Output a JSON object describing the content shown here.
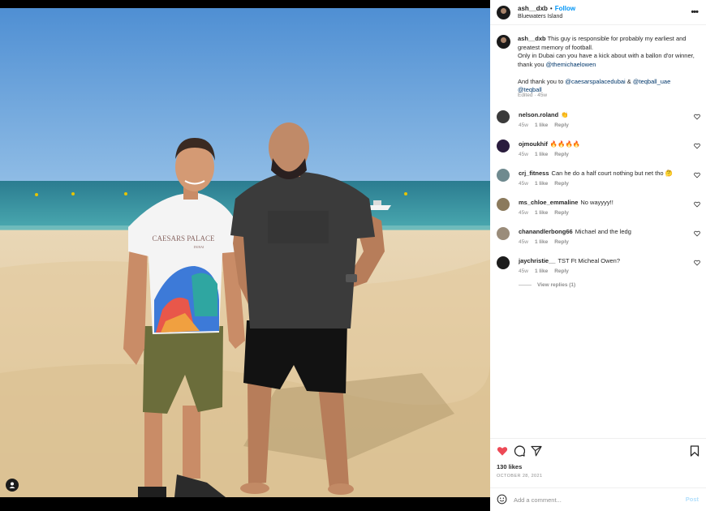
{
  "post": {
    "username": "ash__dxb",
    "separator": "•",
    "follow_label": "Follow",
    "location": "Bluewaters Island",
    "caption": {
      "username": "ash__dxb",
      "line1": "This guy is responsible for probably my earliest and greatest memory of football.",
      "line2_prefix": "Only in Dubai can you have a kick about with a ballon d'or winner, thank you ",
      "mention1": "@themichaelowen",
      "line3_prefix": "And thank you to ",
      "mention2": "@caesarspalacedubai",
      "amp": " & ",
      "mention3": "@teqball_uae",
      "mention4": "@teqball"
    },
    "edited": "Edited · 45w",
    "likes": "130 likes",
    "date": "OCTOBER 28, 2021"
  },
  "photo": {
    "shirt_text": "CAESARS PALACE",
    "shirt_sub": "DUBAI"
  },
  "comments": [
    {
      "user": "nelson.roland",
      "text": "👏",
      "age": "45w",
      "likes": "1 like",
      "reply": "Reply",
      "avatar_color": "#3b3b3b"
    },
    {
      "user": "ojmoukhif",
      "text": "🔥🔥🔥🔥",
      "age": "45w",
      "likes": "1 like",
      "reply": "Reply",
      "avatar_color": "#2a1c3d"
    },
    {
      "user": "crj_fitness",
      "text": "Can he do a half court nothing but net tho 🤔",
      "age": "45w",
      "likes": "1 like",
      "reply": "Reply",
      "avatar_color": "#6f8a8f"
    },
    {
      "user": "ms_chloe_emmaline",
      "text": "No wayyyy!!",
      "age": "45w",
      "likes": "1 like",
      "reply": "Reply",
      "avatar_color": "#8b7a5c"
    },
    {
      "user": "chanandlerbong66",
      "text": "Michael and the ledg",
      "age": "45w",
      "likes": "1 like",
      "reply": "Reply",
      "avatar_color": "#9a8c7a"
    },
    {
      "user": "jaychristie__",
      "text": "TST Ft Micheal Owen?",
      "age": "45w",
      "likes": "1 like",
      "reply": "Reply",
      "avatar_color": "#1c1c1c"
    }
  ],
  "view_replies": "View replies (1)",
  "add_comment": {
    "placeholder": "Add a comment...",
    "post_label": "Post"
  },
  "icons": {
    "like": "heart-icon",
    "comment": "comment-icon",
    "share": "share-icon",
    "save": "bookmark-icon",
    "more": "more-icon",
    "emoji": "emoji-icon",
    "tag": "user-tag-icon"
  },
  "colors": {
    "follow": "#0095f6",
    "mention": "#00376b",
    "liked_heart": "#ed4956",
    "muted": "#8e8e8e",
    "post_disabled": "#b2dffc"
  }
}
